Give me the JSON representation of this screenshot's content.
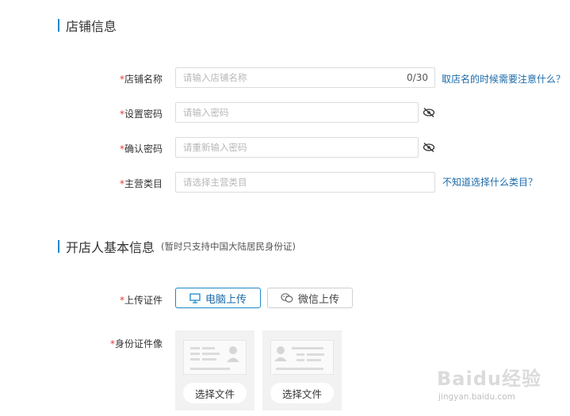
{
  "shop_section": {
    "title": "店铺信息",
    "fields": {
      "shop_name": {
        "required_mark": "*",
        "label": "店铺名称",
        "placeholder": "请输入店铺名称",
        "counter": "0/30",
        "help": "取店名的时候需要注意什么？"
      },
      "password": {
        "required_mark": "*",
        "label": "设置密码",
        "placeholder": "请输入密码",
        "icon": "eye-hidden-icon"
      },
      "confirm_password": {
        "required_mark": "*",
        "label": "确认密码",
        "placeholder": "请重新输入密码",
        "icon": "eye-hidden-icon"
      },
      "category": {
        "required_mark": "*",
        "label": "主营类目",
        "placeholder": "请选择主营类目",
        "help": "不知道选择什么类目？"
      }
    }
  },
  "owner_section": {
    "title": "开店人基本信息",
    "note": "(暂时只支持中国大陆居民身份证)",
    "upload": {
      "required_mark": "*",
      "label": "上传证件",
      "pc_button": "电脑上传",
      "wechat_button": "微信上传"
    },
    "id_photo": {
      "required_mark": "*",
      "label": "身份证件像",
      "front_button": "选择文件",
      "back_button": "选择文件"
    }
  },
  "watermark": {
    "brand": "Baidu经验",
    "url": "jingyan.baidu.com"
  },
  "colors": {
    "accent": "#1b88c9",
    "link": "#1b6aa8",
    "required": "#e4393c"
  }
}
